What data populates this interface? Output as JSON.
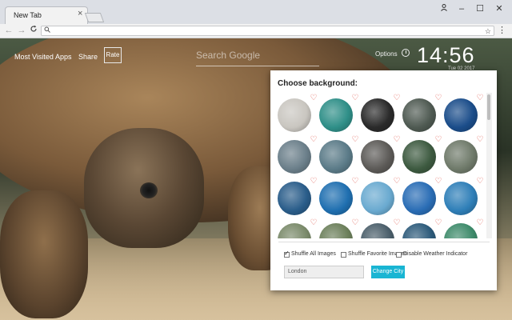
{
  "browser": {
    "tab_title": "New Tab",
    "tab_close": "×",
    "new_tab_label": "",
    "window_controls": {
      "profile": "⍝",
      "minimize": "–",
      "maximize": "☐",
      "close": "✕"
    },
    "nav": {
      "back": "←",
      "forward": "→",
      "reload": "C"
    },
    "omnibox": {
      "value": "",
      "search_icon": "🔍︎",
      "star_icon": "☆"
    },
    "menu_icon": "⋮"
  },
  "page": {
    "links": [
      "Most Visited",
      "Apps",
      "Share"
    ],
    "rate_label": "Rate",
    "search_placeholder": "Search Google",
    "options_label": "Options",
    "time": "14:56",
    "date": "Tue 02 2017"
  },
  "panel": {
    "title": "Choose background:",
    "thumbnail_colors": [
      [
        "#c9c6c0",
        "#2f8f88",
        "#2a2a2a",
        "#4f5a52",
        "#1b4d8a"
      ],
      [
        "#6b7f8a",
        "#5b7b88",
        "#5c5a57",
        "#3d5a40",
        "#6f7a6a"
      ],
      [
        "#2a5d8a",
        "#1f6fb0",
        "#6aaad0",
        "#2a6db5",
        "#2f7fb8"
      ],
      [
        "#7a8a6a",
        "#6b7f5a",
        "#4a5e6a",
        "#2c5a7a",
        "#3d8a6a"
      ]
    ],
    "heart_icon": "♡",
    "options": [
      {
        "label": "Shuffle All Images",
        "checked": true
      },
      {
        "label": "Shuffle Favorite Images",
        "checked": false
      },
      {
        "label": "Disable Weather Indicator",
        "checked": false
      }
    ],
    "city_value": "London",
    "change_city_label": "Change City"
  }
}
